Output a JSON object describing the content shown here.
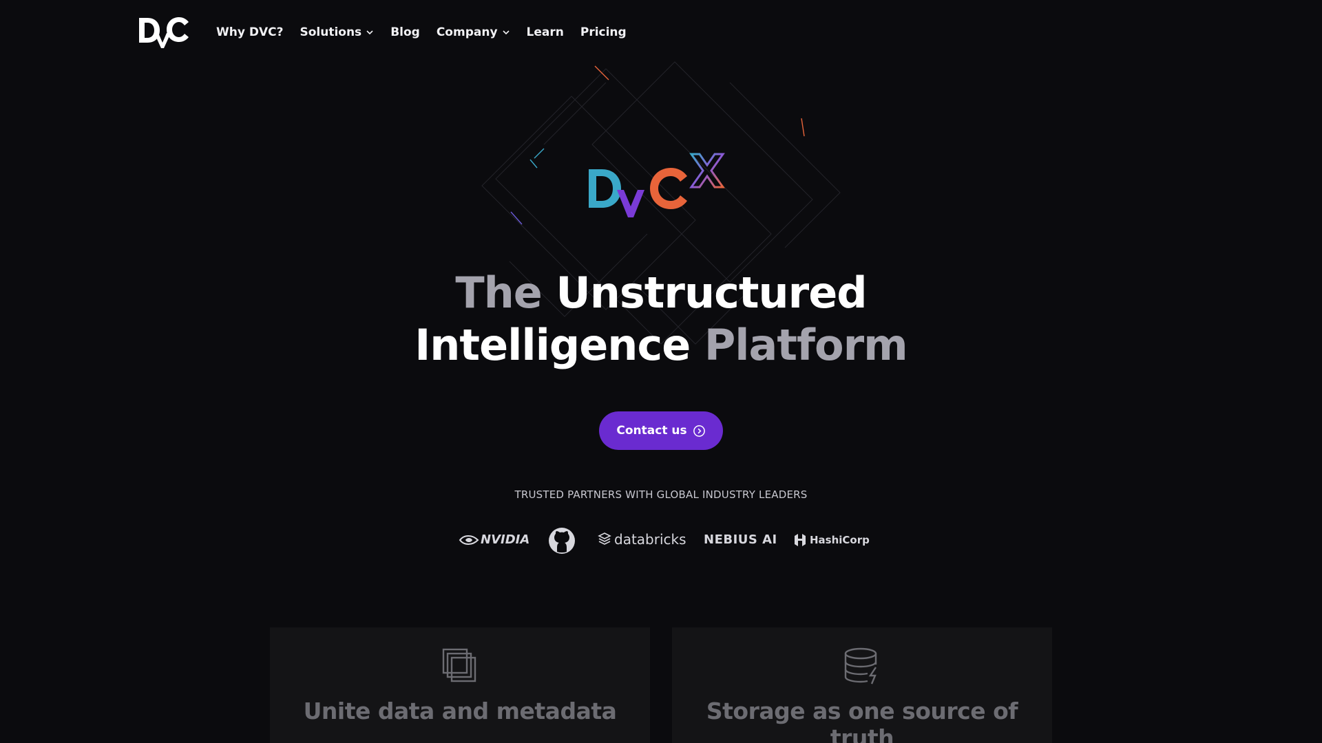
{
  "nav": {
    "logo_alt": "DVC",
    "items": [
      {
        "label": "Why DVC?",
        "has_dropdown": false
      },
      {
        "label": "Solutions",
        "has_dropdown": true
      },
      {
        "label": "Blog",
        "has_dropdown": false
      },
      {
        "label": "Company",
        "has_dropdown": true
      },
      {
        "label": "Learn",
        "has_dropdown": false
      },
      {
        "label": "Pricing",
        "has_dropdown": false
      }
    ]
  },
  "hero": {
    "product_logo": "DVCX",
    "headline": {
      "word1": "The",
      "word2": "Unstructured",
      "word3": "Intelligence",
      "word4": "Platform"
    },
    "cta_label": "Contact us",
    "cta_icon": "arrow-circle-right-icon"
  },
  "partners": {
    "heading": "TRUSTED PARTNERS WITH GLOBAL INDUSTRY LEADERS",
    "logos": [
      {
        "name": "NVIDIA",
        "icon": "nvidia-eye-icon"
      },
      {
        "name": "",
        "icon": "github-icon"
      },
      {
        "name": "databricks",
        "icon": "databricks-stack-icon"
      },
      {
        "name": "NEBIUS AI",
        "icon": ""
      },
      {
        "name": "HashiCorp",
        "icon": "hashicorp-icon"
      }
    ]
  },
  "features": [
    {
      "title": "Unite data and metadata",
      "icon": "stacked-layers-icon"
    },
    {
      "title": "Storage as one source of truth",
      "icon": "database-bolt-icon"
    }
  ],
  "colors": {
    "background": "#0b0b0e",
    "cta": "#6a2bd0",
    "dim_text": "#a4a3ad",
    "card_bg": "#141416",
    "logo_d": "#3aa8c8",
    "logo_v": "#7a3bd6",
    "logo_c": "#e8643a"
  }
}
